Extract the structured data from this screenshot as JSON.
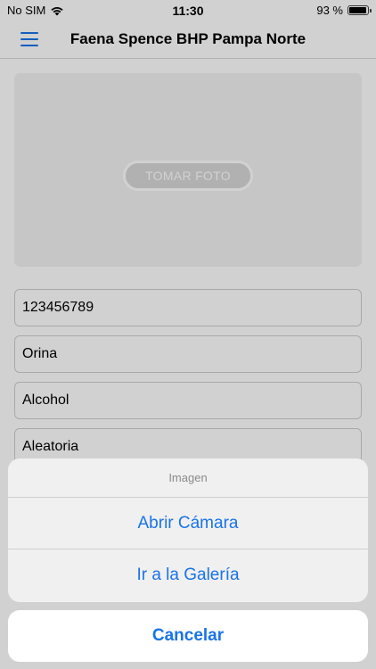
{
  "status_bar": {
    "carrier": "No SIM",
    "time": "11:30",
    "battery": "93 %",
    "battery_level": 0.93,
    "icons": [
      "wifi-icon",
      "battery-icon"
    ]
  },
  "nav": {
    "title": "Faena Spence BHP Pampa Norte",
    "menu_icon": "hamburger-menu-icon"
  },
  "photo": {
    "button_label": "TOMAR FOTO"
  },
  "fields": [
    {
      "value": "123456789"
    },
    {
      "value": "Orina"
    },
    {
      "value": "Alcohol"
    },
    {
      "value": "Aleatoria"
    }
  ],
  "action_sheet": {
    "title": "Imagen",
    "items": [
      {
        "label": "Abrir Cámara"
      },
      {
        "label": "Ir a la Galería"
      }
    ],
    "cancel_label": "Cancelar"
  },
  "colors": {
    "accent": "#1a73e8",
    "sheet_background": "#f0f0f0"
  }
}
